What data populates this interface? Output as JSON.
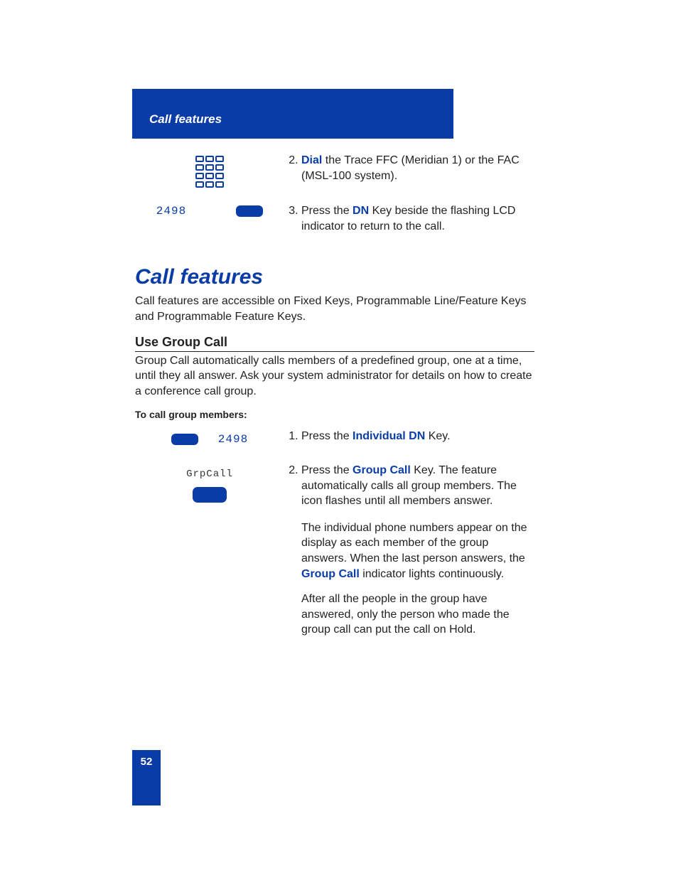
{
  "header": {
    "title": "Call features"
  },
  "top_steps": {
    "step2_kw": "Dial",
    "step2_rest": " the Trace FFC (Meridian 1) or the FAC (MSL-100 system).",
    "step3_a": "Press the ",
    "step3_kw": "DN",
    "step3_b": " Key beside the flashing LCD indicator to return to the call.",
    "dn_label": "2498"
  },
  "section": {
    "title": "Call features",
    "body": "Call features are accessible on Fixed Keys, Programmable Line/Feature Keys and Programmable Feature Keys."
  },
  "subsection": {
    "title": "Use Group Call",
    "body": "Group Call automatically calls members of a predefined group, one at a time, until they all answer. Ask your system administrator for details on how to create a conference call group.",
    "lead_in": "To call group members:"
  },
  "grp_vis": {
    "dn_label": "2498",
    "grp_label": "GrpCall"
  },
  "grp_steps": {
    "s1_a": "Press the ",
    "s1_kw": "Individual DN",
    "s1_b": " Key.",
    "s2_a": "Press the ",
    "s2_kw": "Group Call",
    "s2_b": " Key. The feature automatically calls all group members. The icon flashes until all members answer.",
    "p1_a": "The individual phone numbers appear on the display as each member of the group answers. When the last person answers, the ",
    "p1_kw": "Group Call",
    "p1_b": " indicator lights continuously.",
    "p2": "After all the people in the group have answered, only the person who made the group call can put the call on Hold."
  },
  "page_number": "52"
}
